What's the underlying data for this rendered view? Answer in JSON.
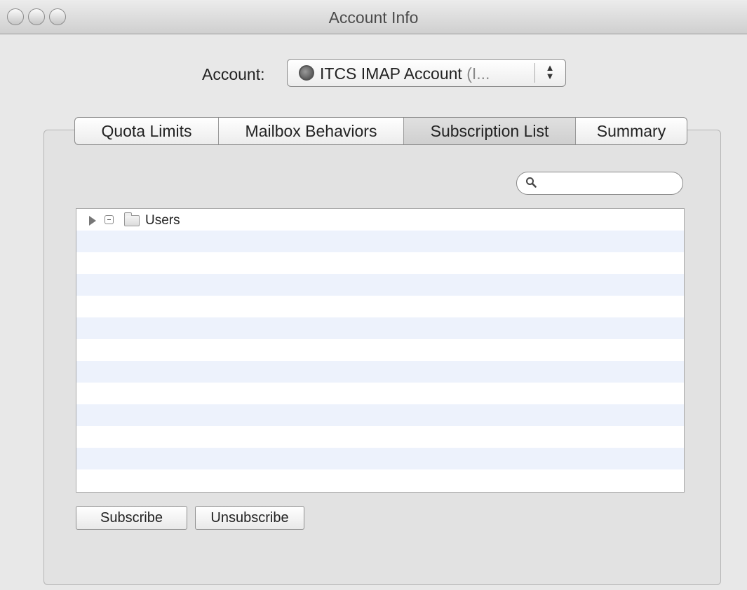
{
  "window": {
    "title": "Account Info"
  },
  "account": {
    "label": "Account:",
    "selected_main": "ITCS IMAP Account",
    "selected_suffix": " (I...",
    "arrows": "▲▼"
  },
  "tabs": [
    {
      "label": "Quota Limits",
      "active": false
    },
    {
      "label": "Mailbox Behaviors",
      "active": false
    },
    {
      "label": "Subscription List",
      "active": true
    },
    {
      "label": "Summary",
      "active": false
    }
  ],
  "search": {
    "value": "",
    "placeholder": ""
  },
  "mailbox_list": {
    "items": [
      {
        "label": "Users"
      }
    ]
  },
  "buttons": {
    "subscribe": "Subscribe",
    "unsubscribe": "Unsubscribe"
  },
  "icons": {
    "window_controls": [
      "close-icon",
      "minimize-icon",
      "zoom-icon"
    ],
    "account": "globe-icon",
    "search": "search-icon",
    "row": [
      "disclosure-triangle-icon",
      "checkbox-icon",
      "folder-icon"
    ]
  },
  "colors": {
    "row_stripe": "#edf2fc",
    "window_bg": "#e8e8e8"
  }
}
